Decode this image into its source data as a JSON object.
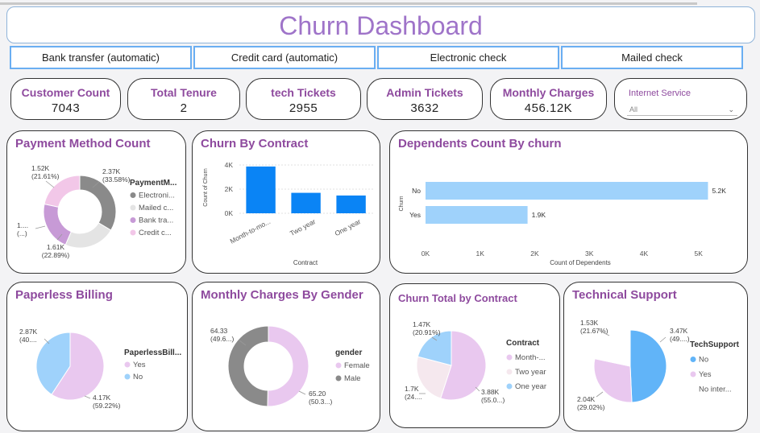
{
  "dashboard": {
    "title": "Churn Dashboard"
  },
  "payment_buttons": [
    "Bank transfer (automatic)",
    "Credit card (automatic)",
    "Electronic check",
    "Mailed check"
  ],
  "kpis": [
    {
      "label": "Customer Count",
      "value": "7043"
    },
    {
      "label": "Total Tenure",
      "value": "2"
    },
    {
      "label": "tech Tickets",
      "value": "2955"
    },
    {
      "label": "Admin Tickets",
      "value": "3632"
    },
    {
      "label": "Monthly Charges",
      "value": "456.12K"
    }
  ],
  "filter": {
    "label": "Internet Service",
    "value": "All"
  },
  "colors": {
    "title": "#9f74c9",
    "card_title": "#8e4a9e",
    "dark_gray": "#8a8a8a",
    "light_gray": "#e4e4e4",
    "purple": "#c79ad6",
    "pink": "#f2c7e8",
    "lilac": "#e9c8ef",
    "blue": "#0a84f5",
    "light_blue": "#9fd2fb",
    "mid_blue": "#61b4f8",
    "pale_pink": "#f5e8ee"
  },
  "chart_data": [
    {
      "id": "payment_method",
      "type": "pie",
      "variant": "donut",
      "title": "Payment Method Count",
      "legend_title": "PaymentM...",
      "legend_position": "right",
      "slices": [
        {
          "label": "Electroni...",
          "value": 2365,
          "color": "#8a8a8a",
          "data_label": "2.37K",
          "pct_label": "(33.58%)"
        },
        {
          "label": "Mailed c...",
          "value": 1612,
          "color": "#e4e4e4",
          "data_label": "1.61K",
          "pct_label": "(22.89%)"
        },
        {
          "label": "Bank tra...",
          "value": 1544,
          "color": "#c79ad6",
          "data_label": "1....",
          "pct_label": "(...)"
        },
        {
          "label": "Credit c...",
          "value": 1522,
          "color": "#f2c7e8",
          "data_label": "1.52K",
          "pct_label": "(21.61%)"
        }
      ]
    },
    {
      "id": "churn_by_contract",
      "type": "bar",
      "title": "Churn By Contract",
      "xlabel": "Contract",
      "ylabel": "Count of Churn",
      "categories": [
        "Month-to-mo...",
        "Two year",
        "One year"
      ],
      "values": [
        3875,
        1695,
        1473
      ],
      "yticks": [
        "0K",
        "2K",
        "4K"
      ],
      "ylim": [
        0,
        4400
      ],
      "grid": true
    },
    {
      "id": "dependents_by_churn",
      "type": "bar",
      "orientation": "horizontal",
      "title": "Dependents Count By churn",
      "xlabel": "Count of Dependents",
      "ylabel": "Churn",
      "categories": [
        "No",
        "Yes"
      ],
      "values": [
        5174,
        1869
      ],
      "data_labels": [
        "5.2K",
        "1.9K"
      ],
      "xticks": [
        "0K",
        "1K",
        "2K",
        "3K",
        "4K",
        "5K"
      ],
      "xlim": [
        0,
        5300
      ]
    },
    {
      "id": "paperless_billing",
      "type": "pie",
      "title": "Paperless Billing",
      "legend_title": "PaperlessBill...",
      "legend_position": "right",
      "slices": [
        {
          "label": "Yes",
          "value": 4171,
          "color": "#e9c8ef",
          "data_label": "4.17K",
          "pct_label": "(59.22%)"
        },
        {
          "label": "No",
          "value": 2872,
          "color": "#9fd2fb",
          "data_label": "2.87K",
          "pct_label": "(40...."
        }
      ]
    },
    {
      "id": "monthly_charges_gender",
      "type": "pie",
      "variant": "donut",
      "title": "Monthly Charges By Gender",
      "legend_title": "gender",
      "legend_position": "right",
      "slices": [
        {
          "label": "Female",
          "value": 65.2,
          "color": "#e9c8ef",
          "data_label": "65.20",
          "pct_label": "(50.3...)"
        },
        {
          "label": "Male",
          "value": 64.33,
          "color": "#8a8a8a",
          "data_label": "64.33",
          "pct_label": "(49.6...)"
        }
      ]
    },
    {
      "id": "churn_total_contract",
      "type": "pie",
      "title": "Churn Total by Contract",
      "legend_title": "Contract",
      "legend_position": "right",
      "slices": [
        {
          "label": "Month-...",
          "value": 3875,
          "color": "#e9c8ef",
          "data_label": "3.88K",
          "pct_label": "(55.0...)"
        },
        {
          "label": "Two year",
          "value": 1695,
          "color": "#f5e8ee",
          "data_label": "1.7K",
          "pct_label": "(24...."
        },
        {
          "label": "One year",
          "value": 1473,
          "color": "#9fd2fb",
          "data_label": "1.47K",
          "pct_label": "(20.91%)"
        }
      ]
    },
    {
      "id": "technical_support",
      "type": "pie",
      "title": "Technical Support",
      "legend_title": "TechSupport",
      "legend_position": "right",
      "slices": [
        {
          "label": "No",
          "value": 3473,
          "color": "#61b4f8",
          "data_label": "3.47K",
          "pct_label": "(49....)"
        },
        {
          "label": "Yes",
          "value": 2044,
          "color": "#e9c8ef",
          "data_label": "2.04K",
          "pct_label": "(29.02%)"
        },
        {
          "label": "No inter...",
          "value": 1526,
          "color": "#ffffff",
          "data_label": "1.53K",
          "pct_label": "(21.67%)"
        }
      ]
    }
  ]
}
